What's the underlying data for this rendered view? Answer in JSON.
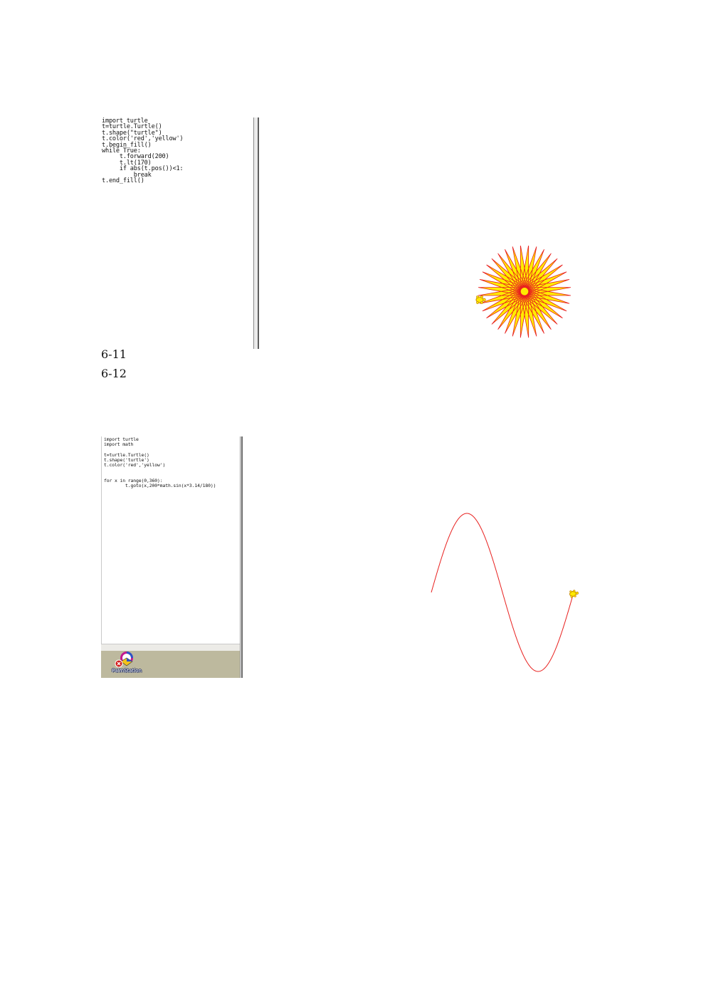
{
  "figure_6_11": {
    "caption": "6-11",
    "code": "import turtle\nt=turtle.Turtle()\nt.shape(\"turtle\")\nt.color('red','yellow')\nt.begin_fill()\nwhile True:\n     t.forward(200)\n     t.lt(170)\n     if abs(t.pos())<1:\n         break\nt.end_fill()",
    "output": {
      "line_color": "#e8201e",
      "fill_color": "#ffeb00",
      "forward": 200,
      "left_turn": 170
    }
  },
  "figure_6_12": {
    "caption": "6-12",
    "code": "import turtle\nimport math\n\nt=turtle.Turtle()\nt.shape('turtle')\nt.color('red','yellow')\n\n\nfor x in range(0,360):\n        t.goto(x,200*math.sin(x*3.14/180))",
    "output": {
      "line_color": "#e8201e",
      "fill_color": "#ffeb00",
      "x_range": [
        0,
        360
      ],
      "amplitude": 200
    },
    "taskbar": {
      "desktop_icon_label": "PalmStation",
      "desktop_icon": "palmstation-app-icon"
    }
  },
  "colors": {
    "turtle_outline": "#c88a00",
    "turtle_fill": "#ffeb00"
  }
}
